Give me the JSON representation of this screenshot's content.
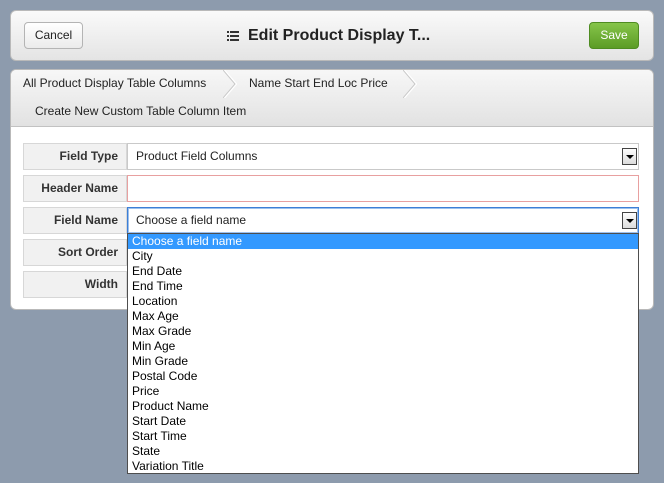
{
  "header": {
    "cancel_label": "Cancel",
    "title": "Edit Product Display T...",
    "title_icon": "list-icon",
    "save_label": "Save",
    "save_color": "#6aab33"
  },
  "breadcrumb": {
    "items": [
      "All Product Display Table Columns",
      "Name Start End Loc Price",
      "Create New Custom Table Column Item"
    ]
  },
  "form": {
    "field_type": {
      "label": "Field Type",
      "value": "Product Field Columns"
    },
    "header_name": {
      "label": "Header Name",
      "value": ""
    },
    "field_name": {
      "label": "Field Name",
      "value": "Choose a field name"
    },
    "sort_order": {
      "label": "Sort Order",
      "value": ""
    },
    "width": {
      "label": "Width",
      "value": ""
    }
  },
  "dropdown": {
    "selected_index": 0,
    "options": [
      "Choose a field name",
      "City",
      "End Date",
      "End Time",
      "Location",
      "Max Age",
      "Max Grade",
      "Min Age",
      "Min Grade",
      "Postal Code",
      "Price",
      "Product Name",
      "Start Date",
      "Start Time",
      "State",
      "Variation Title"
    ]
  }
}
